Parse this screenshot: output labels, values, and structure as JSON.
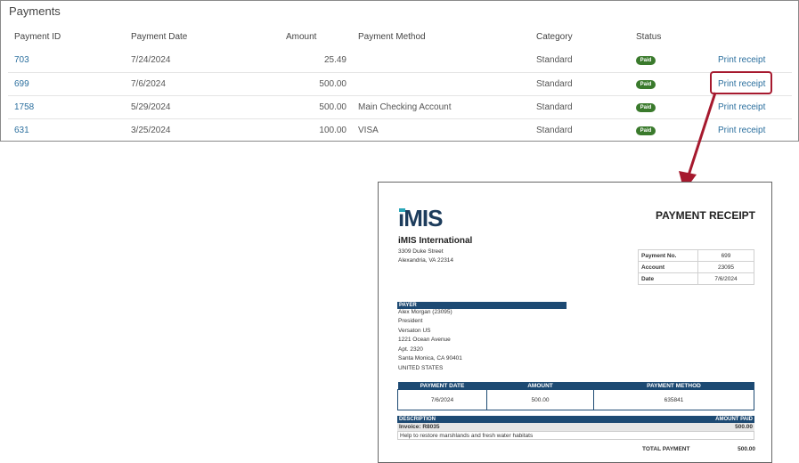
{
  "panel": {
    "title": "Payments"
  },
  "columns": [
    "Payment ID",
    "Payment Date",
    "Amount",
    "Payment Method",
    "Category",
    "Status"
  ],
  "rows": [
    {
      "id": "703",
      "date": "7/24/2024",
      "amount": "25.49",
      "method": "",
      "category": "Standard",
      "status": "Paid",
      "action": "Print receipt"
    },
    {
      "id": "699",
      "date": "7/6/2024",
      "amount": "500.00",
      "method": "",
      "category": "Standard",
      "status": "Paid",
      "action": "Print receipt"
    },
    {
      "id": "1758",
      "date": "5/29/2024",
      "amount": "500.00",
      "method": "Main Checking Account",
      "category": "Standard",
      "status": "Paid",
      "action": "Print receipt"
    },
    {
      "id": "631",
      "date": "3/25/2024",
      "amount": "100.00",
      "method": "VISA",
      "category": "Standard",
      "status": "Paid",
      "action": "Print receipt"
    }
  ],
  "colors": {
    "link": "#2b6f9e",
    "paid": "#3a7a2c",
    "highlight": "#a6192e",
    "receipt_bar": "#1d4a73"
  },
  "receipt": {
    "logo": "iMIS",
    "title": "PAYMENT RECEIPT",
    "org_name": "iMIS International",
    "org_address": [
      "3309 Duke Street",
      "Alexandria, VA 22314"
    ],
    "meta": [
      {
        "label": "Payment No.",
        "value": "699"
      },
      {
        "label": "Account",
        "value": "23095"
      },
      {
        "label": "Date",
        "value": "7/6/2024"
      }
    ],
    "payer_label": "PAYER",
    "payer_lines": [
      "Alex Morgan (23095)",
      "President",
      "Versaton US",
      "1221 Ocean Avenue",
      "Apt. 2320",
      "Santa Monica, CA 90401",
      "UNITED STATES"
    ],
    "pm_headers": [
      "PAYMENT DATE",
      "AMOUNT",
      "PAYMENT METHOD"
    ],
    "pm_values": [
      "7/6/2024",
      "500.00",
      "635841"
    ],
    "desc_label": "DESCRIPTION",
    "amount_paid_label": "AMOUNT PAID",
    "invoice_label": "Invoice: R8035",
    "invoice_amount": "500.00",
    "invoice_desc": "Help to restore marshlands and fresh water habitats",
    "total_label": "TOTAL PAYMENT",
    "total_value": "500.00"
  }
}
